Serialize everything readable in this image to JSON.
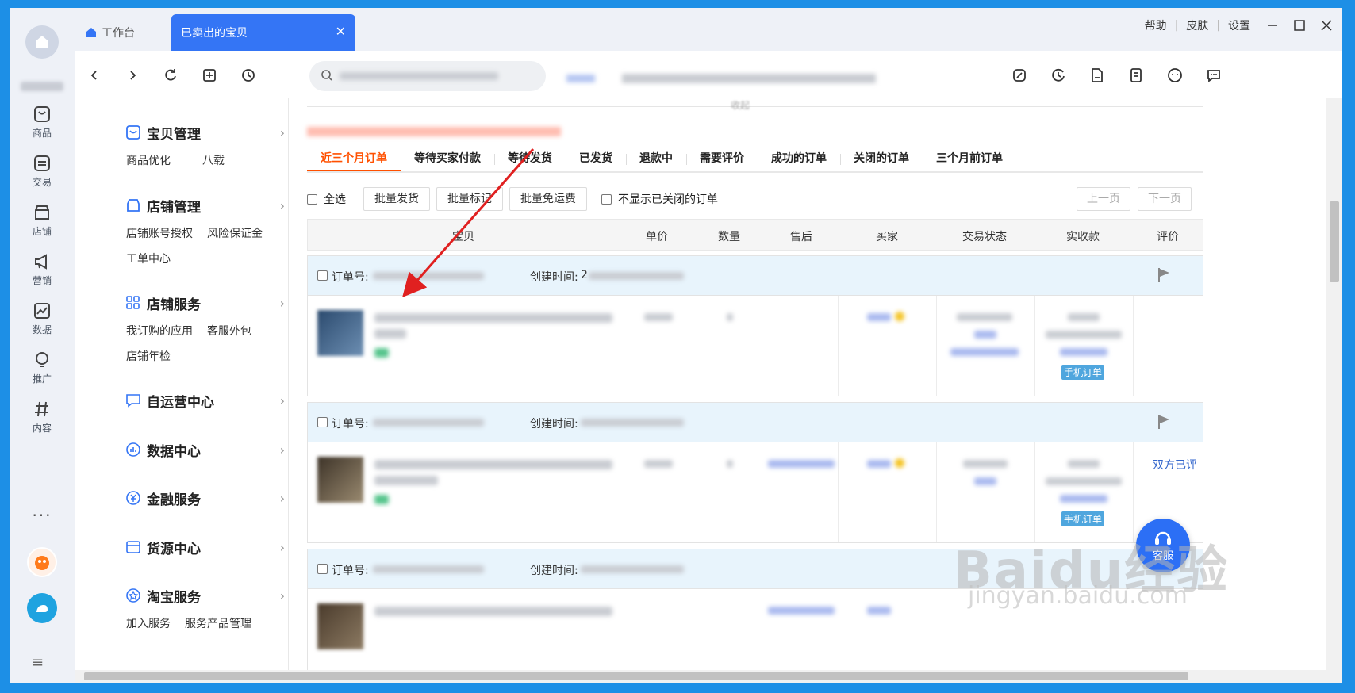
{
  "tabs": {
    "home_label": "工作台",
    "active_label": "已卖出的宝贝",
    "close_glyph": "✕"
  },
  "top_links": {
    "help": "帮助",
    "skin": "皮肤",
    "settings": "设置"
  },
  "left_rail": [
    {
      "label": "商品",
      "icon": "bag-icon"
    },
    {
      "label": "交易",
      "icon": "trade-icon"
    },
    {
      "label": "店铺",
      "icon": "store-icon"
    },
    {
      "label": "营销",
      "icon": "megaphone-icon"
    },
    {
      "label": "数据",
      "icon": "chart-icon"
    },
    {
      "label": "推广",
      "icon": "bulb-icon"
    },
    {
      "label": "内容",
      "icon": "hash-icon"
    }
  ],
  "rail_more": "···",
  "rail_menu": "≡",
  "sidebar": {
    "sections": [
      {
        "title": "宝贝管理",
        "icon": "bag-icon",
        "links": [
          "商品优化",
          "八载"
        ]
      },
      {
        "title": "店铺管理",
        "icon": "store-icon",
        "links": [
          "店铺账号授权",
          "风险保证金",
          "工单中心"
        ]
      },
      {
        "title": "店铺服务",
        "icon": "grid-icon",
        "links": [
          "我订购的应用",
          "客服外包",
          "店铺年检"
        ]
      },
      {
        "title": "自运营中心",
        "icon": "chat-icon",
        "links": []
      },
      {
        "title": "数据中心",
        "icon": "bar-icon",
        "links": []
      },
      {
        "title": "金融服务",
        "icon": "yuan-icon",
        "links": []
      },
      {
        "title": "货源中心",
        "icon": "card-icon",
        "links": []
      },
      {
        "title": "淘宝服务",
        "icon": "star-icon",
        "links": [
          "加入服务",
          "服务产品管理"
        ]
      }
    ],
    "chevron": "›"
  },
  "main": {
    "collapse_text": "收起",
    "order_tabs": [
      "近三个月订单",
      "等待买家付款",
      "等待发货",
      "已发货",
      "退款中",
      "需要评价",
      "成功的订单",
      "关闭的订单",
      "三个月前订单"
    ],
    "active_tab_index": 0,
    "actions": {
      "select_all": "全选",
      "batch_ship": "批量发货",
      "batch_mark": "批量标记",
      "batch_free_shipping": "批量免运费",
      "hide_closed": "不显示已关闭的订单"
    },
    "pager": {
      "prev": "上一页",
      "next": "下一页"
    },
    "columns": [
      "宝贝",
      "单价",
      "数量",
      "售后",
      "买家",
      "交易状态",
      "实收款",
      "评价"
    ],
    "orders": [
      {
        "order_no_label": "订单号:",
        "created_label": "创建时间:",
        "created_prefix": "2",
        "rating": "",
        "badge": "手机订单"
      },
      {
        "order_no_label": "订单号:",
        "created_label": "创建时间:",
        "created_prefix": "",
        "rating": "双方已评",
        "badge": "手机订单"
      },
      {
        "order_no_label": "订单号:",
        "created_label": "创建时间:",
        "created_prefix": "",
        "rating": "",
        "badge": ""
      }
    ]
  },
  "float_button": {
    "label": "客服"
  },
  "watermark": {
    "main": "Baidu经验",
    "sub": "jingyan.baidu.com"
  },
  "colors": {
    "accent": "#3475f5",
    "tab_active_text": "#ff5000",
    "order_header_bg": "#e8f4fc",
    "annotation_arrow": "#e02020"
  }
}
